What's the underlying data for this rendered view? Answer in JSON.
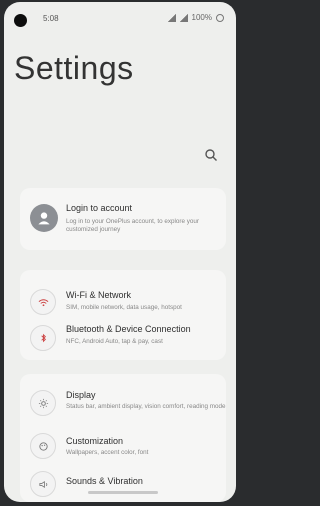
{
  "status_bar": {
    "time": "5:08",
    "battery": "100%"
  },
  "header": {
    "title": "Settings"
  },
  "account": {
    "title": "Login to account",
    "subtitle": "Log in to your OnePlus account, to explore your customized journey"
  },
  "network": [
    {
      "title": "Wi-Fi & Network",
      "subtitle": "SIM, mobile network, data usage, hotspot",
      "icon": "wifi-icon"
    },
    {
      "title": "Bluetooth & Device Connection",
      "subtitle": "NFC, Android Auto, tap & pay, cast",
      "icon": "bluetooth-icon"
    }
  ],
  "display_group": [
    {
      "title": "Display",
      "subtitle": "Status bar, ambient display, vision comfort, reading mode",
      "icon": "brightness-icon"
    },
    {
      "title": "Customization",
      "subtitle": "Wallpapers, accent color, font",
      "icon": "palette-icon"
    },
    {
      "title": "Sounds & Vibration",
      "subtitle": "",
      "icon": "speaker-icon"
    }
  ]
}
